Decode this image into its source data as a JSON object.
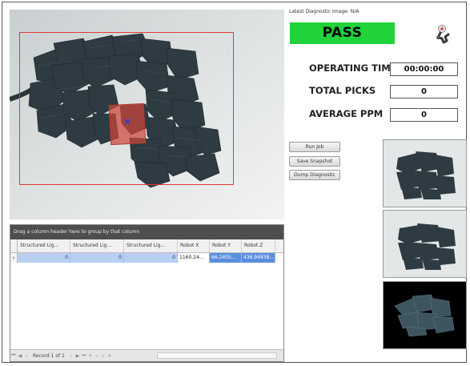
{
  "camera": {
    "roi_color": "#e03a32",
    "pick_color": "#cd463c"
  },
  "grid": {
    "group_header": "Drag a column header here to group by that column",
    "columns": [
      "Structured Lig...",
      "Structured Lig...",
      "Structured Lig...",
      "Robot X",
      "Robot Y",
      "Robot Z"
    ],
    "rows": [
      [
        "0",
        "0",
        "0",
        "1160.24...",
        "66.2405...",
        "436.94838..."
      ]
    ],
    "row_indicator": "›",
    "record_text": "Record 1 of 1"
  },
  "diagnostic": {
    "label": "Latest Diagnostic Image: N/A"
  },
  "status": {
    "text": "PASS",
    "color": "#20d33a"
  },
  "metrics": {
    "operating_time_label": "OPERATING TIME",
    "operating_time_value": "00:00:00",
    "total_picks_label": "TOTAL PICKS",
    "total_picks_value": "0",
    "average_ppm_label": "AVERAGE PPM",
    "average_ppm_value": "0"
  },
  "buttons": {
    "run_job": "Run Job",
    "save_snapshot": "Save Snapshot",
    "dump_diagnostic": "Dump Diagnostic"
  },
  "icons": {
    "settings": "robot-arm-icon"
  }
}
